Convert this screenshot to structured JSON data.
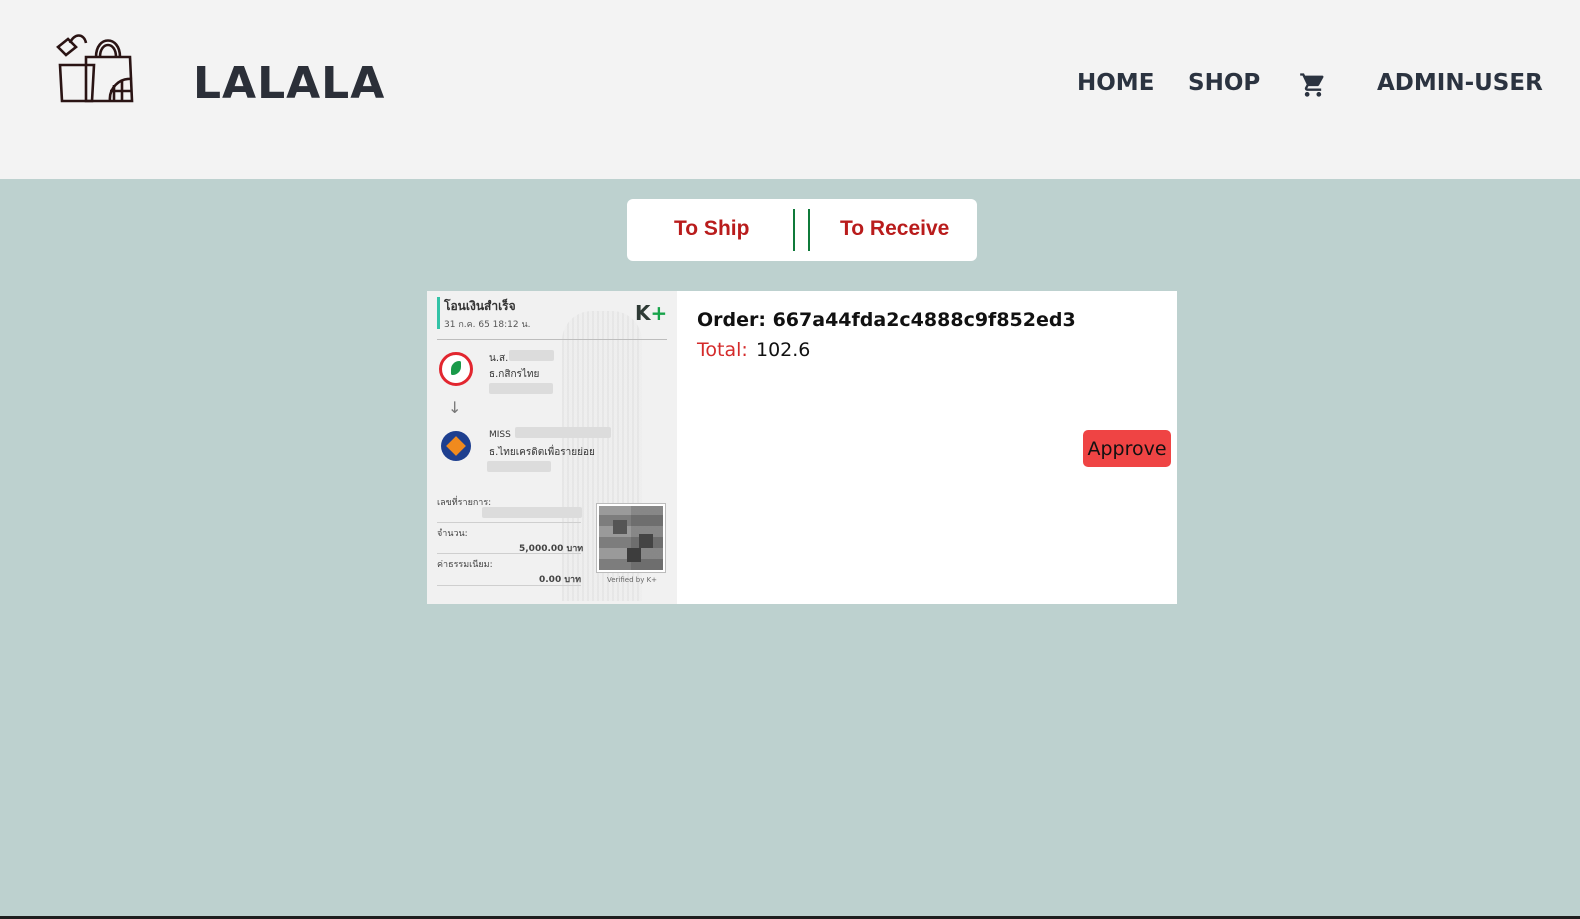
{
  "header": {
    "brand": "LALALA",
    "logo_icon": "shopping-bags-icon",
    "nav": {
      "home": "HOME",
      "shop": "SHOP",
      "cart_icon": "cart-icon",
      "user": "ADMIN-USER"
    }
  },
  "tabs": [
    {
      "label": "To Ship"
    },
    {
      "label": "To Receive"
    }
  ],
  "order": {
    "id_label": "Order: 667a44fda2c4888c9f852ed3",
    "total_label": "Total:",
    "total_value": "102.6",
    "approve_label": "Approve",
    "slip": {
      "title": "โอนเงินสำเร็จ",
      "date": "31 ก.ค. 65  18:12 น.",
      "brand": "K",
      "brand_plus": "+",
      "sender_prefix": "น.ส.",
      "sender_bank": "ธ.กสิกรไทย",
      "receiver_prefix": "MISS",
      "receiver_bank": "ธ.ไทยเครดิตเพื่อรายย่อย",
      "ref_label": "เลขที่รายการ:",
      "amount_label": "จำนวน:",
      "amount_value": "5,000.00 บาท",
      "fee_label": "ค่าธรรมเนียม:",
      "fee_value": "0.00 บาท",
      "verified": "Verified by K+"
    }
  },
  "colors": {
    "page_bg": "#bdd1cf",
    "header_bg": "#f3f3f3",
    "tab_text": "#b91c1c",
    "tab_divider": "#0f7a3a",
    "approve_bg": "#ef4444",
    "total_label": "#d42a2a"
  }
}
